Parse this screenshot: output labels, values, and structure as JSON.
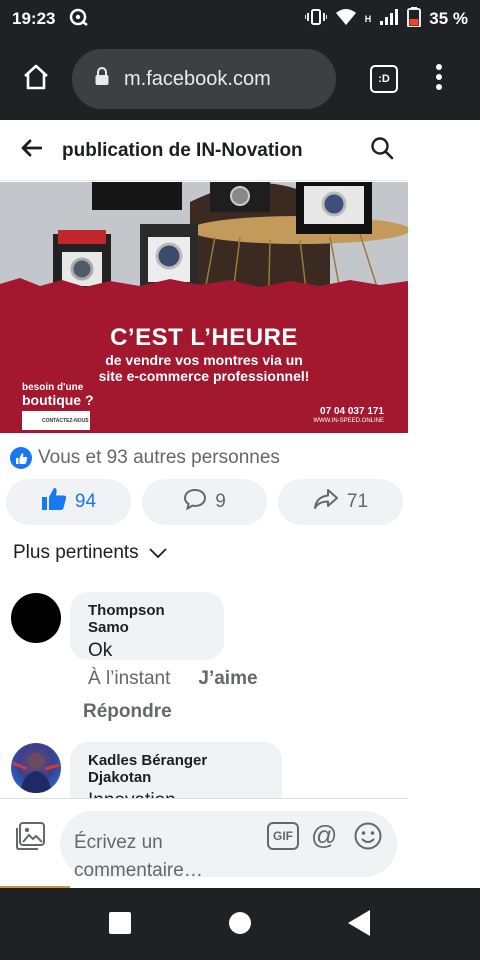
{
  "status_bar": {
    "time": "19:23",
    "network_type": "H",
    "battery": "35 %"
  },
  "browser": {
    "url": "m.facebook.com",
    "tab_label": ":D"
  },
  "header": {
    "title": "publication de IN-Novation"
  },
  "ad": {
    "headline": "C’EST L’HEURE",
    "subline_1": "de vendre vos montres via un",
    "subline_2": "site e-commerce professionnel!",
    "cta_question_1": "besoin d'une",
    "cta_question_2": "boutique ?",
    "cta_button": "CONTACTEZ-NOUS",
    "phone": "07 04 037 171",
    "website": "WWW.IN-SPEED.ONLINE"
  },
  "reactions": {
    "summary": "Vous et 93 autres personnes",
    "like_count": "94",
    "comment_count": "9",
    "share_count": "71"
  },
  "sort": {
    "label": "Plus pertinents"
  },
  "comments": [
    {
      "author": "Thompson Samo",
      "text": "Ok",
      "time": "À l’instant",
      "like_label": "J’aime",
      "reply_label": "Répondre"
    },
    {
      "author": "Kadles Béranger Djakotan",
      "text": "Innovation"
    }
  ],
  "composer": {
    "placeholder_1": "Écrivez un",
    "placeholder_2": "commentaire…",
    "gif_label": "GIF",
    "mention_label": "@"
  },
  "colors": {
    "facebook_blue": "#1877f2",
    "ad_red": "#a3182f",
    "system_bar": "#202124"
  }
}
